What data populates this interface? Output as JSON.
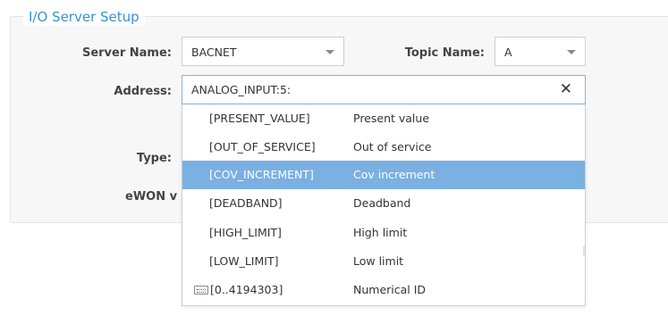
{
  "section": {
    "title": "I/O Server Setup"
  },
  "form": {
    "server_name_label": "Server Name:",
    "server_name_value": "BACNET",
    "topic_name_label": "Topic Name:",
    "topic_name_value": "A",
    "address_label": "Address:",
    "address_value": "ANALOG_INPUT:5:",
    "clear_glyph": "✕",
    "type_label": "Type:",
    "ewon_label": "eWON v"
  },
  "dropdown": {
    "items": [
      {
        "code": "[PRESENT_VALUE]",
        "desc": "Present value",
        "selected": false
      },
      {
        "code": "[OUT_OF_SERVICE]",
        "desc": "Out of service",
        "selected": false
      },
      {
        "code": "[COV_INCREMENT]",
        "desc": "Cov increment",
        "selected": true
      },
      {
        "code": "[DEADBAND]",
        "desc": "Deadband",
        "selected": false
      },
      {
        "code": "[HIGH_LIMIT]",
        "desc": "High limit",
        "selected": false
      },
      {
        "code": "[LOW_LIMIT]",
        "desc": "Low limit",
        "selected": false
      },
      {
        "code": "[0..4194303]",
        "desc": "Numerical ID",
        "selected": false,
        "icon": "keyboard-icon"
      }
    ]
  },
  "colors": {
    "accent": "#3a8fd6",
    "selected_row": "#7ab0e2",
    "focus_border": "#7fb2e5"
  }
}
